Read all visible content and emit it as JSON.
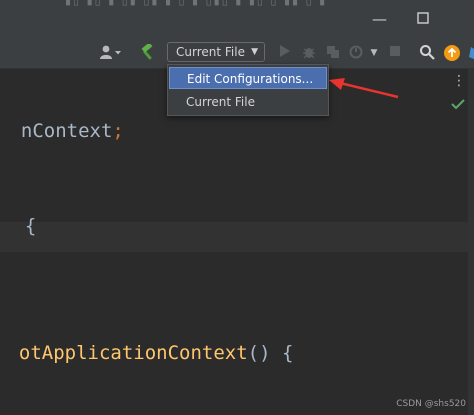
{
  "titlebar": {
    "minimize_icon": "minimize-icon",
    "maximize_icon": "maximize-icon"
  },
  "toolbar": {
    "user_icon": "user-icon",
    "build_icon": "hammer-icon",
    "run_config_selected": "Current File",
    "run_icon": "play-icon",
    "debug_icon": "bug-icon",
    "coverage_icon": "coverage-icon",
    "profile_icon": "profile-icon",
    "stop_icon": "stop-icon",
    "search_icon": "search-icon",
    "update_icon": "update-icon",
    "colors": {
      "accent": "#4b6eaf",
      "build_green": "#4e9a3c",
      "update_orange": "#f59a13",
      "check_green": "#59a869"
    }
  },
  "dropdown": {
    "items": [
      {
        "label": "Edit Configurations..."
      },
      {
        "label": "Current File"
      }
    ]
  },
  "editor": {
    "lines": [
      {
        "text": "nContext",
        "suffix": ";"
      },
      {
        "text": "{"
      },
      {
        "text": "otApplicationContext",
        "suffix": "() {"
      }
    ],
    "inspection_icon": "check-icon",
    "more_icon": "more-vertical-icon"
  },
  "watermark": "CSDN @shs520"
}
